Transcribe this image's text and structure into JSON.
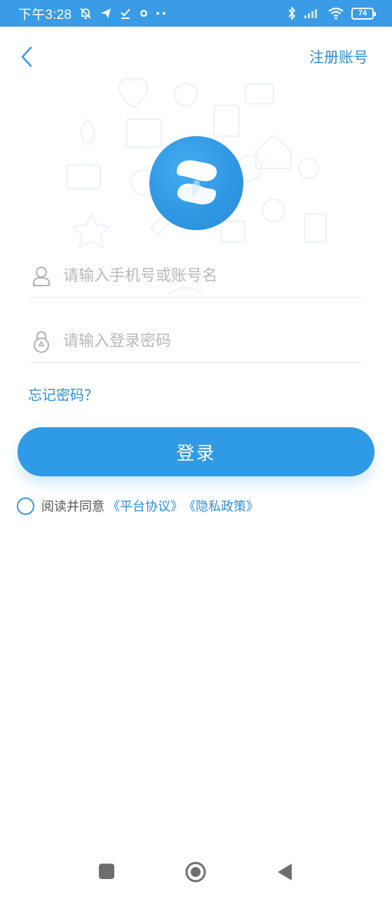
{
  "status_bar": {
    "time": "下午3:28",
    "battery": "74",
    "icons": [
      "mute-bell-icon",
      "send-icon",
      "download-check-icon",
      "dot-icon",
      "more-icon",
      "bluetooth-icon",
      "signal-icon",
      "wifi-icon",
      "battery-icon"
    ]
  },
  "header": {
    "back_icon": "chevron-left-icon",
    "register_label": "注册账号"
  },
  "form": {
    "phone_placeholder": "请输入手机号或账号名",
    "password_placeholder": "请输入登录密码",
    "phone_value": "",
    "password_value": "",
    "forgot_label": "忘记密码？",
    "login_label": "登录"
  },
  "agreement": {
    "prefix": "阅读并同意",
    "platform_link": "《平台协议》",
    "privacy_link": "《隐私政策》",
    "checked": false
  },
  "colors": {
    "accent": "#2f9ae5",
    "link": "#2f8fd6",
    "status_bar": "#3a9be6"
  },
  "nav_bar": {
    "icons": [
      "recents-square-icon",
      "home-circle-icon",
      "back-triangle-icon"
    ]
  }
}
